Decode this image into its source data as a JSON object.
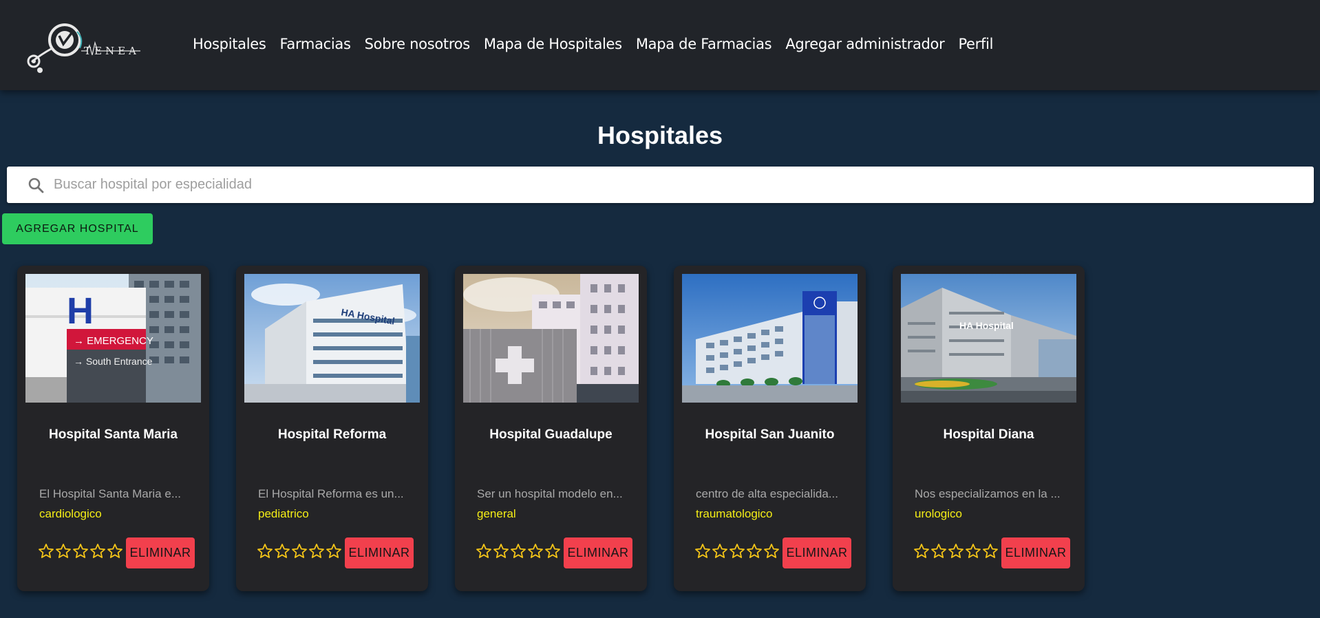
{
  "navbar": {
    "logo_text": "TENEA",
    "links": [
      {
        "label": "Hospitales"
      },
      {
        "label": "Farmacias"
      },
      {
        "label": "Sobre nosotros"
      },
      {
        "label": "Mapa de Hospitales"
      },
      {
        "label": "Mapa de Farmacias"
      },
      {
        "label": "Agregar administrador"
      },
      {
        "label": "Perfil"
      }
    ]
  },
  "page": {
    "title": "Hospitales",
    "search_placeholder": "Buscar hospital por especialidad",
    "search_value": "",
    "add_button_label": "AGREGAR HOSPITAL"
  },
  "colors": {
    "background": "#152a3f",
    "navbar": "#212429",
    "card": "#242427",
    "add_button": "#2ecc5f",
    "delete_button": "#f2404d",
    "specialty": "#f4ed16",
    "star": "#f5c518"
  },
  "cards": [
    {
      "title": "Hospital Santa Maria",
      "description": "El Hospital Santa Maria e...",
      "specialty": "cardiologico",
      "rating": 0,
      "delete_label": "ELIMINAR",
      "image": "hospital-emergency-sign-photo"
    },
    {
      "title": "Hospital Reforma",
      "description": "El Hospital Reforma es un...",
      "specialty": "pediatrico",
      "rating": 0,
      "delete_label": "ELIMINAR",
      "image": "hospital-building-photo"
    },
    {
      "title": "Hospital Guadalupe",
      "description": "Ser un hospital modelo en...",
      "specialty": "general",
      "rating": 0,
      "delete_label": "ELIMINAR",
      "image": "hospital-cross-facade-photo"
    },
    {
      "title": "Hospital San Juanito",
      "description": "centro de alta especialida...",
      "specialty": "traumatologico",
      "rating": 0,
      "delete_label": "ELIMINAR",
      "image": "hospital-blue-glass-photo"
    },
    {
      "title": "Hospital Diana",
      "description": "Nos especializamos en la ...",
      "specialty": "urologico",
      "rating": 0,
      "delete_label": "ELIMINAR",
      "image": "hospital-complex-photo"
    }
  ]
}
